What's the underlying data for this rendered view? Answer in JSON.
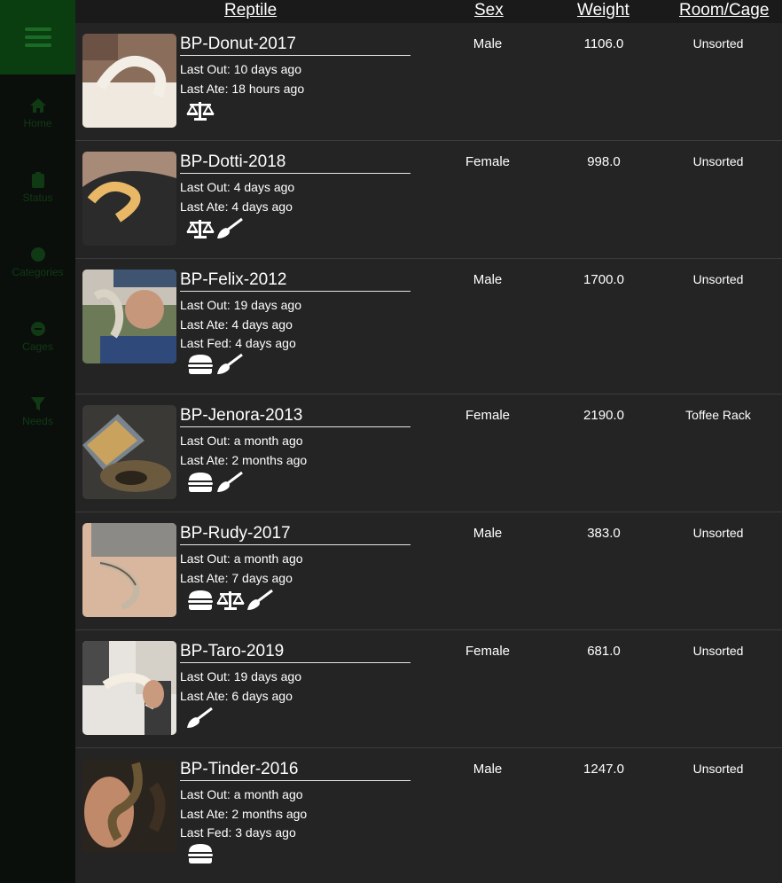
{
  "sidebar": {
    "nav": [
      {
        "label": "Home",
        "icon": "home-icon"
      },
      {
        "label": "Status",
        "icon": "clipboard-icon"
      },
      {
        "label": "Categories",
        "icon": "tag-icon"
      },
      {
        "label": "Cages",
        "icon": "cage-icon"
      },
      {
        "label": "Needs",
        "icon": "filter-icon"
      }
    ]
  },
  "header": {
    "reptile": "Reptile",
    "sex": "Sex",
    "weight": "Weight",
    "room": "Room/Cage"
  },
  "rows": [
    {
      "name": "BP-Donut-2017",
      "lines": [
        "Last Out: 10 days ago",
        "Last Ate: 18 hours ago"
      ],
      "icons": [
        "scale-icon"
      ],
      "sex": "Male",
      "weight": "1106.0",
      "room": "Unsorted"
    },
    {
      "name": "BP-Dotti-2018",
      "lines": [
        "Last Out: 4 days ago",
        "Last Ate: 4 days ago"
      ],
      "icons": [
        "scale-icon",
        "broom-icon"
      ],
      "sex": "Female",
      "weight": "998.0",
      "room": "Unsorted"
    },
    {
      "name": "BP-Felix-2012",
      "lines": [
        "Last Out: 19 days ago",
        "Last Ate: 4 days ago",
        "Last Fed: 4 days ago"
      ],
      "icons": [
        "burger-icon",
        "broom-icon"
      ],
      "sex": "Male",
      "weight": "1700.0",
      "room": "Unsorted"
    },
    {
      "name": "BP-Jenora-2013",
      "lines": [
        "Last Out: a month ago",
        "Last Ate: 2 months ago"
      ],
      "icons": [
        "burger-icon",
        "broom-icon"
      ],
      "sex": "Female",
      "weight": "2190.0",
      "room": "Toffee Rack"
    },
    {
      "name": "BP-Rudy-2017",
      "lines": [
        "Last Out: a month ago",
        "Last Ate: 7 days ago"
      ],
      "icons": [
        "burger-icon",
        "scale-icon",
        "broom-icon"
      ],
      "sex": "Male",
      "weight": "383.0",
      "room": "Unsorted"
    },
    {
      "name": "BP-Taro-2019",
      "lines": [
        "Last Out: 19 days ago",
        "Last Ate: 6 days ago"
      ],
      "icons": [
        "broom-icon"
      ],
      "sex": "Female",
      "weight": "681.0",
      "room": "Unsorted"
    },
    {
      "name": "BP-Tinder-2016",
      "lines": [
        "Last Out: a month ago",
        "Last Ate: 2 months ago",
        "Last Fed: 3 days ago"
      ],
      "icons": [
        "burger-icon"
      ],
      "sex": "Male",
      "weight": "1247.0",
      "room": "Unsorted"
    }
  ]
}
